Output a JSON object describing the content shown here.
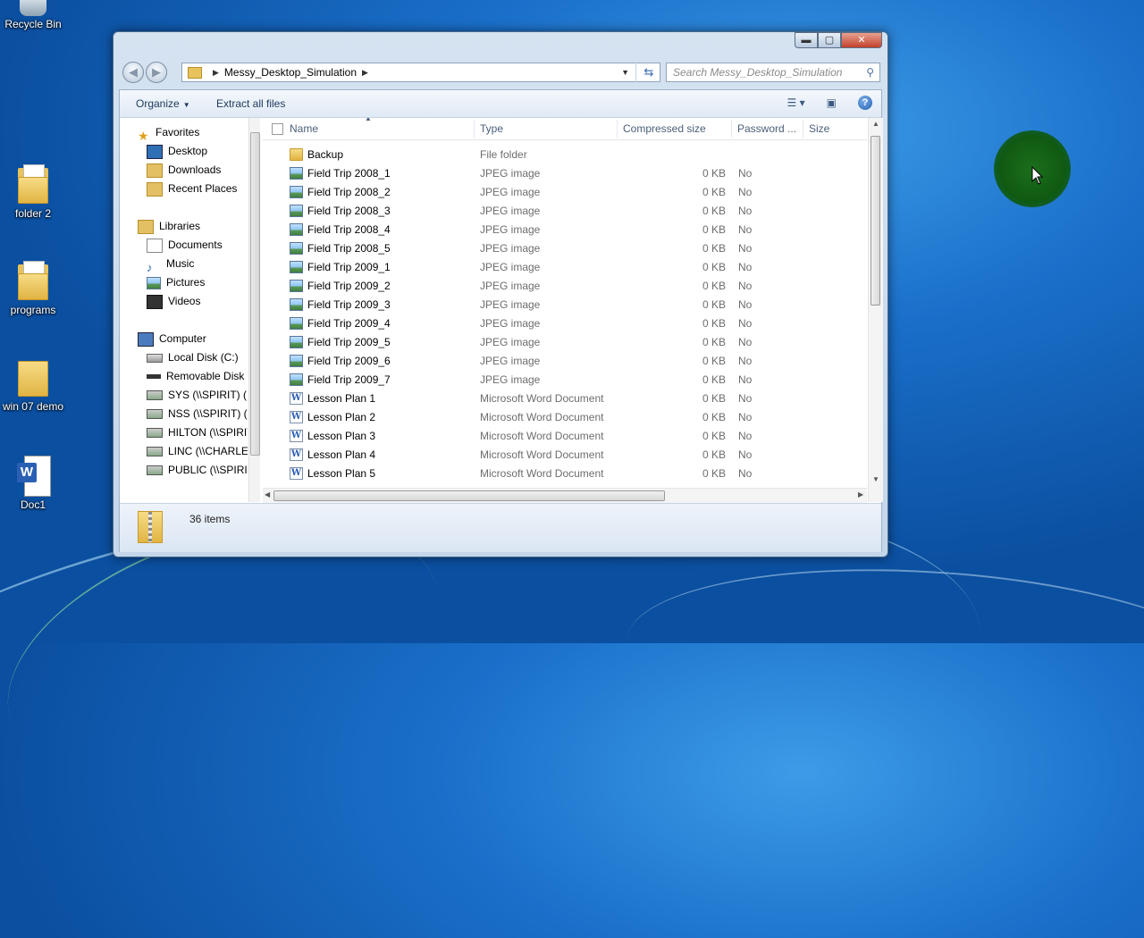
{
  "desktop": {
    "icons": [
      {
        "label": "Recycle Bin"
      },
      {
        "label": "folder 2"
      },
      {
        "label": "programs"
      },
      {
        "label": "win 07 demo"
      },
      {
        "label": "Doc1"
      }
    ]
  },
  "window": {
    "caption_buttons": {
      "minimize": "▬",
      "maximize": "▢",
      "close": "✕"
    },
    "address": {
      "crumb": "Messy_Desktop_Simulation",
      "search_placeholder": "Search Messy_Desktop_Simulation"
    },
    "toolbar": {
      "organize": "Organize",
      "extract": "Extract all files",
      "help": "?"
    },
    "nav": {
      "favorites": "Favorites",
      "desktop": "Desktop",
      "downloads": "Downloads",
      "recent": "Recent Places",
      "libraries": "Libraries",
      "documents": "Documents",
      "music": "Music",
      "pictures": "Pictures",
      "videos": "Videos",
      "computer": "Computer",
      "local_disk": "Local Disk (C:)",
      "removable": "Removable Disk (",
      "sys": "SYS (\\\\SPIRIT) (F:",
      "nss": "NSS (\\\\SPIRIT) (G",
      "hilton": "HILTON (\\\\SPIRIT",
      "linc": "LINC (\\\\CHARLES",
      "public": "PUBLIC (\\\\SPIRIT"
    },
    "columns": {
      "name": "Name",
      "type": "Type",
      "compressed": "Compressed size",
      "password": "Password ...",
      "size": "Size"
    },
    "files": [
      {
        "name": "Backup",
        "type": "File folder",
        "compressed": "",
        "password": "",
        "kind": "folder"
      },
      {
        "name": "Field Trip 2008_1",
        "type": "JPEG image",
        "compressed": "0 KB",
        "password": "No",
        "kind": "jpg"
      },
      {
        "name": "Field Trip 2008_2",
        "type": "JPEG image",
        "compressed": "0 KB",
        "password": "No",
        "kind": "jpg"
      },
      {
        "name": "Field Trip 2008_3",
        "type": "JPEG image",
        "compressed": "0 KB",
        "password": "No",
        "kind": "jpg"
      },
      {
        "name": "Field Trip 2008_4",
        "type": "JPEG image",
        "compressed": "0 KB",
        "password": "No",
        "kind": "jpg"
      },
      {
        "name": "Field Trip 2008_5",
        "type": "JPEG image",
        "compressed": "0 KB",
        "password": "No",
        "kind": "jpg"
      },
      {
        "name": "Field Trip 2009_1",
        "type": "JPEG image",
        "compressed": "0 KB",
        "password": "No",
        "kind": "jpg"
      },
      {
        "name": "Field Trip 2009_2",
        "type": "JPEG image",
        "compressed": "0 KB",
        "password": "No",
        "kind": "jpg"
      },
      {
        "name": "Field Trip 2009_3",
        "type": "JPEG image",
        "compressed": "0 KB",
        "password": "No",
        "kind": "jpg"
      },
      {
        "name": "Field Trip 2009_4",
        "type": "JPEG image",
        "compressed": "0 KB",
        "password": "No",
        "kind": "jpg"
      },
      {
        "name": "Field Trip 2009_5",
        "type": "JPEG image",
        "compressed": "0 KB",
        "password": "No",
        "kind": "jpg"
      },
      {
        "name": "Field Trip 2009_6",
        "type": "JPEG image",
        "compressed": "0 KB",
        "password": "No",
        "kind": "jpg"
      },
      {
        "name": "Field Trip 2009_7",
        "type": "JPEG image",
        "compressed": "0 KB",
        "password": "No",
        "kind": "jpg"
      },
      {
        "name": "Lesson Plan 1",
        "type": "Microsoft Word Document",
        "compressed": "0 KB",
        "password": "No",
        "kind": "doc"
      },
      {
        "name": "Lesson Plan 2",
        "type": "Microsoft Word Document",
        "compressed": "0 KB",
        "password": "No",
        "kind": "doc"
      },
      {
        "name": "Lesson Plan 3",
        "type": "Microsoft Word Document",
        "compressed": "0 KB",
        "password": "No",
        "kind": "doc"
      },
      {
        "name": "Lesson Plan 4",
        "type": "Microsoft Word Document",
        "compressed": "0 KB",
        "password": "No",
        "kind": "doc"
      },
      {
        "name": "Lesson Plan 5",
        "type": "Microsoft Word Document",
        "compressed": "0 KB",
        "password": "No",
        "kind": "doc"
      }
    ],
    "status": {
      "count": "36 items"
    }
  }
}
